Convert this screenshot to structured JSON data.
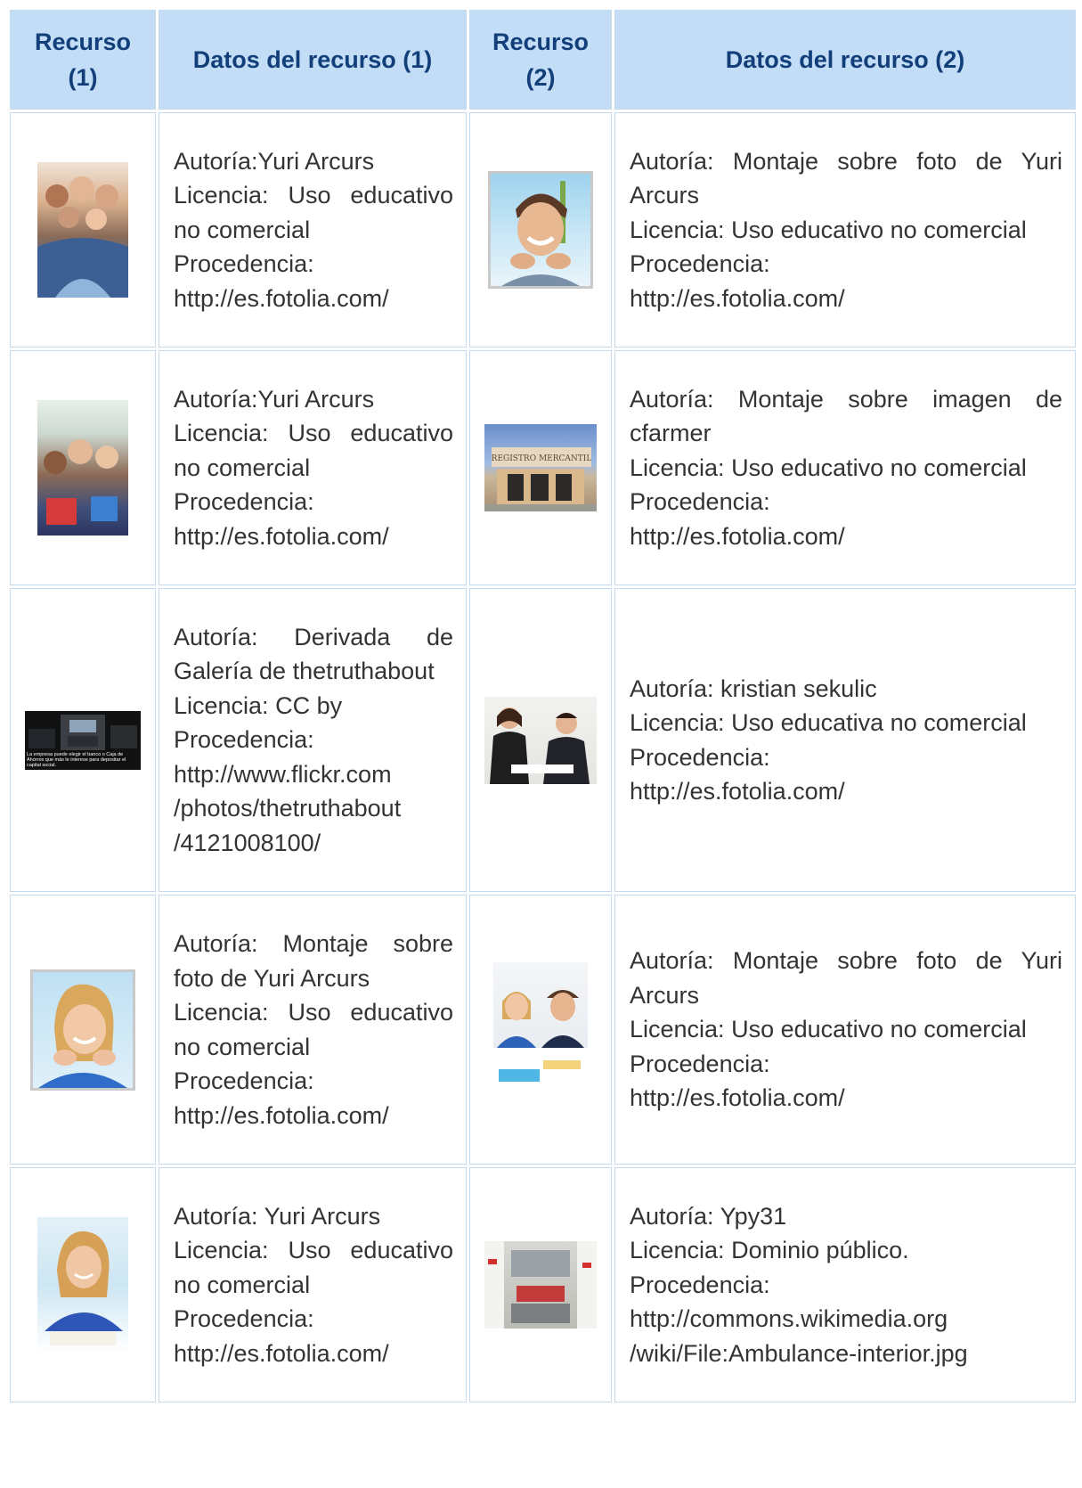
{
  "header": {
    "col1": "Recurso (1)",
    "col2": "Datos del recurso (1)",
    "col3": "Recurso (2)",
    "col4": "Datos del recurso (2)"
  },
  "rows": [
    {
      "left": {
        "image": "group-of-teens-photo",
        "lines": [
          "Autoría:Yuri Arcurs",
          "Licencia: Uso educativo no comercial",
          "Procedencia:",
          "http://es.fotolia.com/"
        ]
      },
      "right": {
        "image": "smiling-boy-photo",
        "lines": [
          "Autoría: Montaje sobre foto de Yuri Arcurs",
          "Licencia: Uso educativo no comercial",
          "Procedencia:",
          "http://es.fotolia.com/"
        ]
      }
    },
    {
      "left": {
        "image": "students-with-books-photo",
        "lines": [
          "Autoría:Yuri Arcurs",
          "Licencia: Uso educativo no comercial",
          "Procedencia:",
          "http://es.fotolia.com/"
        ]
      },
      "right": {
        "image": "registro-mercantil-building-photo",
        "sign": "REGISTRO MERCANTIL",
        "lines": [
          "Autoría: Montaje sobre imagen de cfarmer",
          "Licencia: Uso educativo no comercial",
          "Procedencia:",
          "http://es.fotolia.com/"
        ]
      }
    },
    {
      "left": {
        "image": "bank-atm-screenshot",
        "caption": "La empresa puede elegir el banco o Caja de Ahorros que más le interese para depositar el capital social.",
        "lines": [
          "Autoría: Derivada de Galería de thetruthabout",
          "Licencia: CC by",
          "Procedencia:",
          "http://www.flickr.com",
          "/photos/thetruthabout",
          "/4121008100/"
        ]
      },
      "right": {
        "image": "business-meeting-photo",
        "lines": [
          "Autoría: kristian sekulic",
          "Licencia: Uso educativa no comercial",
          "Procedencia:",
          "http://es.fotolia.com/"
        ]
      }
    },
    {
      "left": {
        "image": "smiling-girl-photo",
        "lines": [
          "Autoría: Montaje sobre foto de Yuri Arcurs",
          "Licencia: Uso educativo no comercial",
          "Procedencia:",
          "http://es.fotolia.com/"
        ]
      },
      "right": {
        "image": "two-students-studying-photo",
        "lines": [
          "Autoría: Montaje sobre foto de Yuri Arcurs",
          "Licencia: Uso educativo no comercial",
          "Procedencia:",
          "http://es.fotolia.com/"
        ]
      }
    },
    {
      "left": {
        "image": "girl-reading-photo",
        "lines": [
          "Autoría: Yuri Arcurs",
          "Licencia: Uso educativo no comercial",
          "Procedencia:",
          "http://es.fotolia.com/"
        ]
      },
      "right": {
        "image": "ambulance-interior-photo",
        "lines": [
          "Autoría: Ypy31",
          "Licencia: Dominio público.",
          "Procedencia:",
          "http://commons.wikimedia.org",
          "/wiki/File:Ambulance-interior.jpg"
        ]
      }
    }
  ]
}
